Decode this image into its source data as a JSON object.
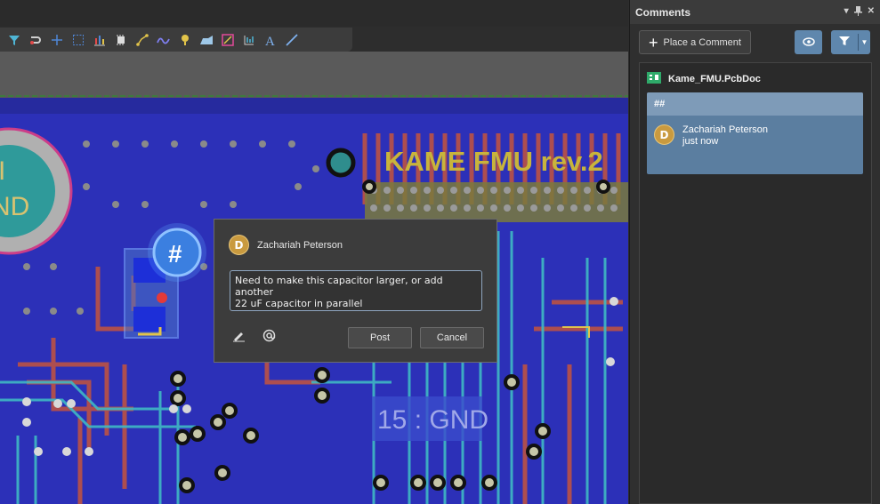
{
  "toolbar": {
    "icons": [
      "filter-icon",
      "route-icon",
      "cross-icon",
      "selection-box-icon",
      "chart-icon",
      "component-icon",
      "net-icon",
      "interactive-route-icon",
      "pad-icon",
      "polygon-icon",
      "dimension-icon",
      "via-icon",
      "text-icon",
      "line-icon"
    ]
  },
  "pcb": {
    "title_text": "KAME FMU rev.2",
    "gnd_label": "15 : GND",
    "big_pad_text_a": "I",
    "big_pad_text_b": "ND",
    "marker": "#"
  },
  "popup": {
    "author": "Zachariah Peterson",
    "avatar_letter": "D",
    "comment_text": "Need to make this capacitor larger, or add another\n22 uF capacitor in parallel",
    "post_label": "Post",
    "cancel_label": "Cancel"
  },
  "panel": {
    "title": "Comments",
    "place_comment_label": "Place a Comment",
    "file_name": "Kame_FMU.PcbDoc",
    "thread": {
      "marker": "##",
      "author": "Zachariah Peterson",
      "time": "just now",
      "avatar_letter": "D"
    }
  },
  "colors": {
    "board_blue": "#2c30b8",
    "trace_red": "#b4504a",
    "trace_cyan": "#3fb9c4",
    "silkscreen": "#c8b43c",
    "panel_highlight": "#5b7ea0"
  }
}
